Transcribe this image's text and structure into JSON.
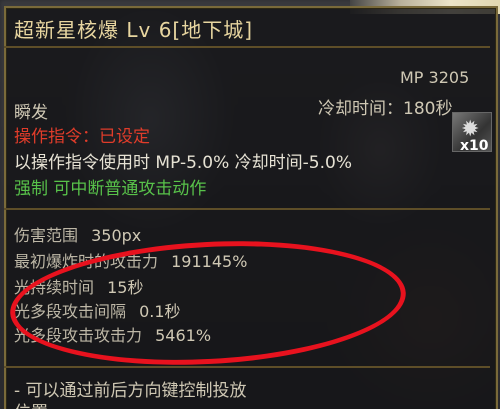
{
  "tooltip": {
    "title": "超新星核爆 Lv 6[地下城]",
    "mp": "MP 3205",
    "cast_type": "瞬发",
    "cooldown": "冷却时间：180秒",
    "command": "操作指令：已设定",
    "command_effect": "以操作指令使用时 MP-5.0% 冷却时间-5.0%",
    "force": "强制  可中断普通攻击动作",
    "skill_icon_count": "x10",
    "stats": [
      {
        "label": "伤害范围",
        "value": "350px"
      },
      {
        "label": "最初爆炸时的攻击力",
        "value": "191145%"
      },
      {
        "label": "光持续时间",
        "value": "15秒"
      },
      {
        "label": "光多段攻击间隔",
        "value": "0.1秒"
      },
      {
        "label": "光多段攻击攻击力",
        "value": "5461%"
      }
    ],
    "note": "- 可以通过前后方向键控制投放",
    "note_cont": "位置"
  },
  "colors": {
    "title": "#e8d6a0",
    "command": "#e03c2a",
    "force": "#58c24a",
    "highlight": "#e8121e"
  },
  "icons": {
    "skill": "nuclear-blast-icon"
  }
}
